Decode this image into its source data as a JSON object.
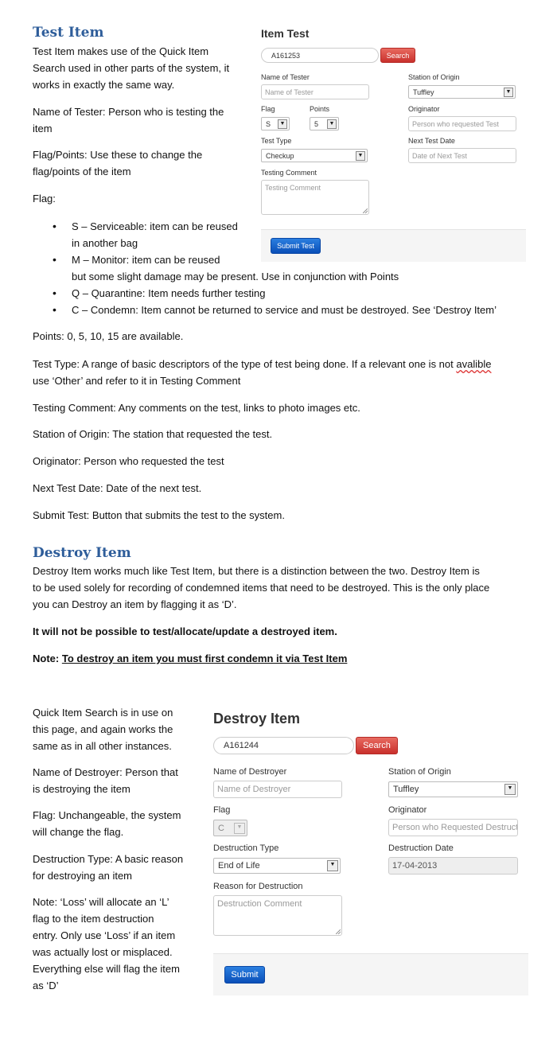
{
  "test_section": {
    "heading": "Test Item",
    "intro_lines": [
      "Test Item makes use of the Quick Item",
      "Search used in other parts of the system, it",
      "works in exactly the same way."
    ],
    "tester_lines": [
      "Name of Tester: Person who is testing the",
      "item"
    ],
    "flagpoints_lines": [
      "Flag/Points: Use these to change the",
      "flag/points of the item"
    ],
    "flag_heading": "Flag:",
    "bullet_s": [
      "S – Serviceable: item can be reused",
      "in another bag"
    ],
    "bullet_m": [
      "M – Monitor: item can be reused",
      "but some slight damage may be present. Use in conjunction with Points"
    ],
    "bullet_q": "Q – Quarantine: Item needs further testing",
    "bullet_c": "C – Condemn: Item cannot be returned to service and must be destroyed. See ‘Destroy Item’",
    "points": "Points: 0, 5, 10, 15 are available.",
    "test_type_line1_a": "Test Type: A range of basic descriptors of the type of test being done. If a  relevant one is not ",
    "test_type_misspelled": "avalible",
    "test_type_line2": "use ‘Other’ and refer to it in Testing Comment",
    "testing_comment": "Testing Comment: Any comments on the test, links to photo images etc.",
    "station_origin": "Station of Origin:  The station that requested the test.",
    "originator": "Originator: Person who requested the test",
    "next_test": "Next Test Date: Date of the next test.",
    "submit_test": "Submit Test: Button that submits the test to the system."
  },
  "item_test_form": {
    "title": "Item Test",
    "search_value": "A161253",
    "search_button": "Search",
    "name_of_tester_label": "Name of Tester",
    "name_of_tester_placeholder": "Name of Tester",
    "station_label": "Station of Origin",
    "station_value": "Tuffley",
    "flag_label": "Flag",
    "flag_value": "S",
    "points_label": "Points",
    "points_value": "5",
    "originator_label": "Originator",
    "originator_placeholder": "Person who requested Test",
    "test_type_label": "Test Type",
    "test_type_value": "Checkup",
    "next_test_label": "Next Test Date",
    "next_test_placeholder": "Date of Next Test",
    "comment_label": "Testing Comment",
    "comment_placeholder": "Testing Comment",
    "submit_button": "Submit Test"
  },
  "destroy_section": {
    "heading": "Destroy Item",
    "intro_lines": [
      "Destroy Item works much like Test Item, but there is a distinction between the two. Destroy Item is",
      "to be used solely for recording of condemned items that need to be destroyed. This is the only place",
      "you can Destroy an item by flagging it as ‘D’."
    ],
    "bold_line": "It will not be possible to test/allocate/update a destroyed item.",
    "note_label": "Note: ",
    "note_text": "To destroy an item you must first condemn it via Test Item",
    "side_quick": [
      "Quick Item Search is in use on",
      "this page, and again works the",
      "same as in all other instances."
    ],
    "side_destroyer": [
      "Name of Destroyer: Person that",
      "is destroying the item"
    ],
    "side_flag": [
      "Flag: Unchangeable, the system",
      "will change the flag."
    ],
    "side_type": [
      "Destruction Type: A basic reason",
      "for destroying an item"
    ],
    "side_note": [
      "Note: ‘Loss’ will allocate an ‘L’",
      "flag to the item destruction",
      "entry. Only use ‘Loss’ if an item",
      "was actually lost or misplaced.",
      "Everything else will flag the item",
      "as ‘D’"
    ]
  },
  "destroy_form": {
    "title": "Destroy Item",
    "search_value": "A161244",
    "search_button": "Search",
    "destroyer_label": "Name of Destroyer",
    "destroyer_placeholder": "Name of Destroyer",
    "station_label": "Station of Origin",
    "station_value": "Tuffley",
    "flag_label": "Flag",
    "flag_value": "C",
    "originator_label": "Originator",
    "originator_placeholder": "Person who Requested Destructi",
    "type_label": "Destruction Type",
    "type_value": "End of Life",
    "date_label": "Destruction Date",
    "date_value": "17-04-2013",
    "reason_label": "Reason for Destruction",
    "reason_placeholder": "Destruction Comment",
    "submit_button": "Submit"
  },
  "colors": {
    "heading_blue": "#2e5d9a",
    "search_red": "#d9534f",
    "submit_blue": "#0d5bc6",
    "panel_grey": "#f5f5f5"
  }
}
